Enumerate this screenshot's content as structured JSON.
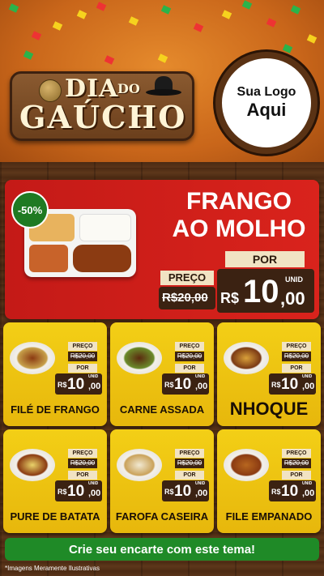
{
  "header": {
    "sign_line1": "DIA",
    "sign_do": "DO",
    "sign_line2": "GAÚCHO",
    "logo_line1": "Sua Logo",
    "logo_line2": "Aqui"
  },
  "hero": {
    "badge": "-50%",
    "title_line1": "FRANGO",
    "title_line2": "AO MOLHO",
    "preco_label": "PREÇO",
    "old_price": "R$20,00",
    "por_label": "POR",
    "currency": "R$",
    "price_int": "10",
    "price_cents": ",00",
    "unid": "UNID"
  },
  "cards": [
    {
      "name": "FILÉ DE FRANGO",
      "preco": "PREÇO",
      "old": "R$20,00",
      "por": "POR",
      "rs": "R$",
      "int": "10",
      "cents": ",00",
      "unid": "UNID"
    },
    {
      "name": "CARNE ASSADA",
      "preco": "PREÇO",
      "old": "R$20,00",
      "por": "POR",
      "rs": "R$",
      "int": "10",
      "cents": ",00",
      "unid": "UNID"
    },
    {
      "name": "NHOQUE",
      "preco": "PREÇO",
      "old": "R$20,00",
      "por": "POR",
      "rs": "R$",
      "int": "10",
      "cents": ",00",
      "unid": "UNID"
    },
    {
      "name": "PURE DE BATATA",
      "preco": "PREÇO",
      "old": "R$20,00",
      "por": "POR",
      "rs": "R$",
      "int": "10",
      "cents": ",00",
      "unid": "UNID"
    },
    {
      "name": "FAROFA CASEIRA",
      "preco": "PREÇO",
      "old": "R$20,00",
      "por": "POR",
      "rs": "R$",
      "int": "10",
      "cents": ",00",
      "unid": "UNID"
    },
    {
      "name": "FILE EMPANADO",
      "preco": "PREÇO",
      "old": "R$20,00",
      "por": "POR",
      "rs": "R$",
      "int": "10",
      "cents": ",00",
      "unid": "UNID"
    }
  ],
  "cta": "Crie seu encarte com este tema!",
  "disclaimer": "*Imagens Meramente Ilustrativas",
  "colors": {
    "hero_red": "#d11f1a",
    "card_yellow": "#f0c613",
    "cta_green": "#1f8a27",
    "wood_dark": "#4d2b13"
  }
}
